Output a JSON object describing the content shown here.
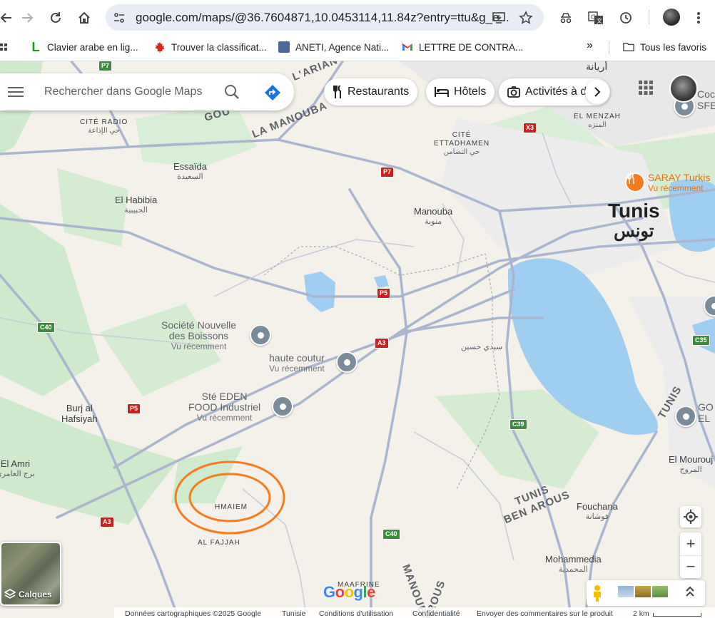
{
  "browser": {
    "url": "google.com/maps/@36.7604871,10.0453114,11.84z?entry=ttu&g_e...",
    "bookmarks": [
      {
        "label": "Clavier arabe en lig...",
        "icon": "letter-l-icon"
      },
      {
        "label": "Trouver la classificat...",
        "icon": "maple-leaf-icon"
      },
      {
        "label": "ANETI, Agence Nati...",
        "icon": "aneti-logo-icon"
      },
      {
        "label": "LETTRE DE CONTRA...",
        "icon": "gmail-icon"
      }
    ],
    "more_bookmarks": "»",
    "all_bookmarks": "Tous les favoris"
  },
  "maps": {
    "search_placeholder": "Rechercher dans Google Maps",
    "chips": [
      "Restaurants",
      "Hôtels",
      "Activités à d"
    ],
    "layers_label": "Calques",
    "logo": "Google",
    "footer": [
      "Données cartographiques ©2025 Google",
      "Tunisie",
      "Conditions d'utilisation",
      "Confidentialité",
      "Envoyer des commentaires sur le produit",
      "2 km"
    ],
    "zoom_in": "+",
    "zoom_out": "−"
  },
  "places": {
    "tunis": {
      "name": "Tunis",
      "ar": "تونس"
    },
    "essaida": {
      "name": "Essaïda",
      "ar": "السعيدة"
    },
    "habibia": {
      "name": "El Habibia",
      "ar": "الحبيبية"
    },
    "manouba": {
      "name": "Manouba",
      "ar": "منوبة"
    },
    "burj": {
      "name": "Burj al\nHafsiyah"
    },
    "elamri": {
      "name": "El Amri",
      "ar": "برج العامري"
    },
    "mourouj": {
      "name": "El Mourouj",
      "ar": "المروج"
    },
    "fouchana": {
      "name": "Fouchana",
      "ar": "فوشانة"
    },
    "mohammedia": {
      "name": "Mohammedia",
      "ar": "المحمدية"
    },
    "sidi_hsine": {
      "ar": "سيدي حسين"
    },
    "ariana": {
      "ar": "أريانة"
    },
    "cite_radio": {
      "name": "CITÉ RADIO",
      "ar": "حي الإذاعة"
    },
    "cite_ettadhamen": {
      "name": "CITÉ\nETTADHAMEN",
      "ar": "حي التضامن"
    },
    "el_menzah": {
      "name": "EL MENZAH",
      "ar": "المنزه"
    },
    "hmaiem": {
      "name": "HMAIEM"
    },
    "al_fajjah": {
      "name": "AL FAJJAH"
    },
    "maafrine": {
      "name": "MAAFRINE"
    },
    "la_manouba": {
      "name": "LA MANOUBA"
    },
    "gou": {
      "name": "GOU"
    },
    "lariana": {
      "name": "L'ARIAN"
    },
    "tunis_ben_arous": {
      "name": "TUNIS\nBEN AROUS"
    },
    "tunis_rot": {
      "name": "TUNIS"
    },
    "manouba_bottom": {
      "name": "MANOUBA"
    },
    "arous_bottom": {
      "name": "AROUS"
    }
  },
  "pois": [
    {
      "name": "Société Nouvelle\ndes Boissons",
      "sub": "Vu récemment"
    },
    {
      "name": "haute coutur",
      "sub": "Vu récemment"
    },
    {
      "name": "Sté EDEN\nFOOD Industriel",
      "sub": "Vu récemment"
    },
    {
      "name": "SARAY Turkis",
      "sub": "Vu récemment"
    },
    {
      "name": "Coc\nSFE",
      "sub": ""
    },
    {
      "name": "GO\nEL",
      "sub": ""
    }
  ],
  "road_shields": [
    "P7",
    "X3",
    "P7",
    "P5",
    "A3",
    "C40",
    "P5",
    "C39",
    "C35",
    "A3",
    "C40"
  ],
  "colors": {
    "accent_orange": "#f57c1f",
    "shield_green": "#3d8b3d",
    "water": "#9fcef0",
    "park": "#c6e8c5"
  }
}
